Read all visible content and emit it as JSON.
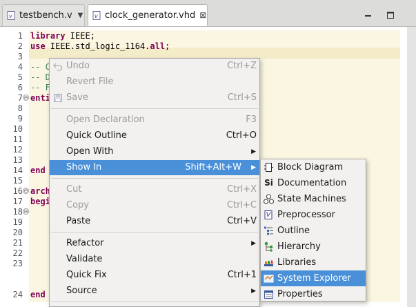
{
  "tabs": [
    {
      "label": "testbench.v",
      "icon": "verilog-file-icon",
      "active": false
    },
    {
      "label": "clock_generator.vhd",
      "icon": "verilog-file-icon",
      "active": true,
      "close_glyph": "⊠"
    }
  ],
  "window_controls": {
    "minimize": "minimize-icon",
    "maximize": "maximize-icon"
  },
  "editor": {
    "line_numbers": [
      "1",
      "2",
      "3",
      "4",
      "5",
      "6",
      "7",
      "8",
      "9",
      "10",
      "11",
      "12",
      "13",
      "14",
      "15",
      "16",
      "17",
      "18",
      "19",
      "20",
      "21",
      "22",
      "23",
      "24"
    ],
    "fold_markers": [
      "⊖",
      "⊖",
      "⊖"
    ],
    "code": {
      "l1_kw": "library",
      "l1_rest": " IEEE;",
      "l2_kw": "use",
      "l2_rest": " IEEE.std_logic_1164.",
      "l2_kw2": "all",
      "l2_end": ";",
      "l4": "-- C",
      "l5": "-- D",
      "l6": "-- F",
      "l7": "enti",
      "l14": "end",
      "l16": "arch",
      "l17": "begi",
      "l24": "end"
    }
  },
  "context_menu": {
    "items": [
      {
        "label": "Undo",
        "shortcut": "Ctrl+Z",
        "disabled": true,
        "icon": "undo-icon"
      },
      {
        "label": "Revert File",
        "shortcut": "",
        "disabled": true
      },
      {
        "label": "Save",
        "shortcut": "Ctrl+S",
        "disabled": true,
        "icon": "save-icon"
      },
      {
        "label": "Open Declaration",
        "shortcut": "F3",
        "disabled": true
      },
      {
        "label": "Quick Outline",
        "shortcut": "Ctrl+O",
        "disabled": false
      },
      {
        "label": "Open With",
        "shortcut": "",
        "disabled": false,
        "submenu": true
      },
      {
        "label": "Show In",
        "shortcut": "Shift+Alt+W",
        "disabled": false,
        "submenu": true,
        "selected": true
      },
      {
        "label": "Cut",
        "shortcut": "Ctrl+X",
        "disabled": true
      },
      {
        "label": "Copy",
        "shortcut": "Ctrl+C",
        "disabled": true
      },
      {
        "label": "Paste",
        "shortcut": "Ctrl+V",
        "disabled": false
      },
      {
        "label": "Refactor",
        "shortcut": "",
        "disabled": false,
        "submenu": true
      },
      {
        "label": "Validate",
        "shortcut": "",
        "disabled": false
      },
      {
        "label": "Quick Fix",
        "shortcut": "Ctrl+1",
        "disabled": false
      },
      {
        "label": "Source",
        "shortcut": "",
        "disabled": false,
        "submenu": true
      }
    ],
    "submenu_arrow": "▶"
  },
  "show_in_submenu": {
    "items": [
      {
        "label": "Block Diagram",
        "icon": "block-diagram-icon"
      },
      {
        "label": "Documentation",
        "icon": "documentation-icon",
        "glyph": "Si"
      },
      {
        "label": "State Machines",
        "icon": "state-machines-icon"
      },
      {
        "label": "Preprocessor",
        "icon": "preprocessor-icon",
        "glyph": "V"
      },
      {
        "label": "Outline",
        "icon": "outline-icon"
      },
      {
        "label": "Hierarchy",
        "icon": "hierarchy-icon"
      },
      {
        "label": "Libraries",
        "icon": "libraries-icon"
      },
      {
        "label": "System Explorer",
        "icon": "system-explorer-icon",
        "selected": true
      },
      {
        "label": "Properties",
        "icon": "properties-icon"
      }
    ]
  },
  "colors": {
    "selection": "#4a90d9",
    "keyword": "#7f0055",
    "comment": "#3f7f5f",
    "editor_bg": "#fbf6e2"
  }
}
